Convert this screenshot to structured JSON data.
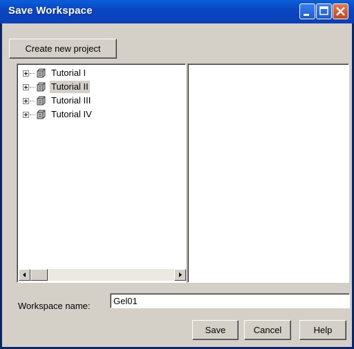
{
  "window": {
    "title": "Save Workspace"
  },
  "toolbar": {
    "create_project_label": "Create new project"
  },
  "tree": {
    "items": [
      {
        "label": "Tutorial I",
        "selected": false
      },
      {
        "label": "Tutorial II",
        "selected": true
      },
      {
        "label": "Tutorial III",
        "selected": false
      },
      {
        "label": "Tutorial IV",
        "selected": false
      }
    ]
  },
  "form": {
    "workspace_name_label": "Workspace name:",
    "workspace_name_value": "Gel01"
  },
  "buttons": {
    "save": "Save",
    "cancel": "Cancel",
    "help": "Help"
  }
}
